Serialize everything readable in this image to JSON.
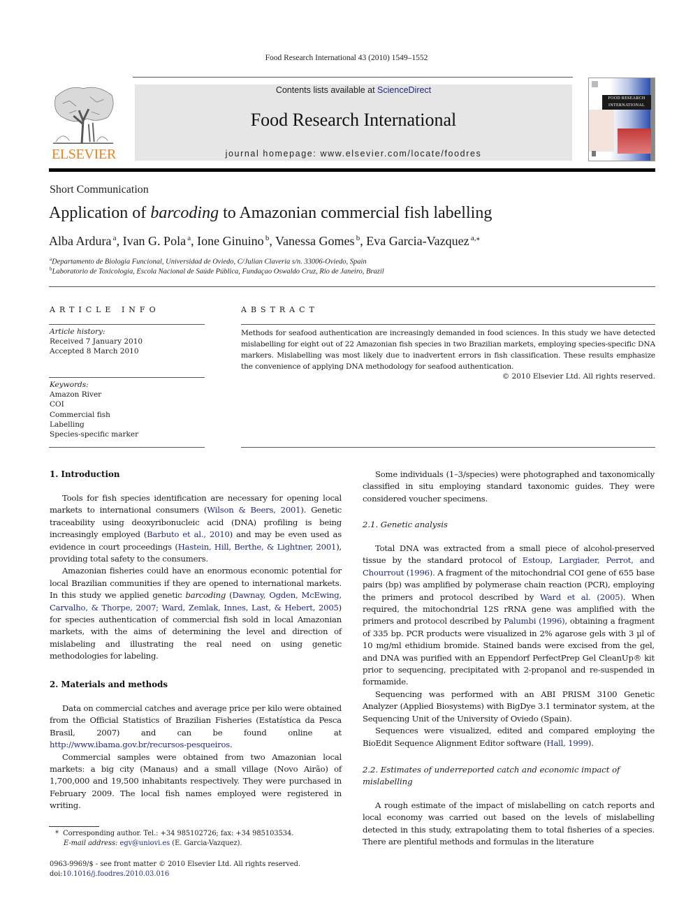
{
  "running_header": "Food Research International 43 (2010) 1549–1552",
  "masthead": {
    "publisher_logo_word": "ELSEVIER",
    "contents_prefix": "Contents lists available at ",
    "contents_link": "ScienceDirect",
    "journal_title": "Food Research International",
    "homepage_line": "journal homepage: www.elsevier.com/locate/foodres",
    "cover": {
      "title_line_1": "FOOD RESEARCH",
      "title_line_2": "INTERNATIONAL"
    },
    "colors": {
      "elsevier_orange": "#f07f1c",
      "link_blue": "#1f2a80",
      "box_grey": "#e6e6e6"
    }
  },
  "article": {
    "type": "Short Communication",
    "title_before": "Application of ",
    "title_italic": "barcoding",
    "title_after": " to Amazonian commercial fish labelling",
    "authors": [
      {
        "name": "Alba Ardura",
        "sup": "a",
        "sep": ", "
      },
      {
        "name": "Ivan G. Pola",
        "sup": "a",
        "sep": ", "
      },
      {
        "name": "Ione Ginuino",
        "sup": "b",
        "sep": ", "
      },
      {
        "name": "Vanessa Gomes",
        "sup": "b",
        "sep": ", "
      },
      {
        "name": "Eva Garcia-Vazquez",
        "sup": "a,⁎",
        "sep": ""
      }
    ],
    "affiliations": [
      {
        "sup": "a",
        "text": "Departamento de Biologia Funcional, Universidad de Oviedo, C/Julian Claveria s/n. 33006-Oviedo, Spain"
      },
      {
        "sup": "b",
        "text": "Laboratorio de Toxicologia, Escola Nacional de Saúde Pública, Fundaçao Oswaldo Cruz, Rio de Janeiro, Brazil"
      }
    ]
  },
  "article_info": {
    "heading": "ARTICLE INFO",
    "history_label": "Article history:",
    "received": "Received 7 January 2010",
    "accepted": "Accepted 8 March 2010",
    "keywords_label": "Keywords:",
    "keywords": [
      "Amazon River",
      "COI",
      "Commercial fish",
      "Labelling",
      "Species-specific marker"
    ]
  },
  "abstract": {
    "heading": "ABSTRACT",
    "text": "Methods for seafood authentication are increasingly demanded in food sciences. In this study we have detected mislabelling for eight out of 22 Amazonian fish species in two Brazilian markets, employing species-specific DNA markers. Mislabelling was most likely due to inadvertent errors in fish classification. These results emphasize the convenience of applying DNA methodology for seafood authentication.",
    "copyright": "© 2010 Elsevier Ltd. All rights reserved."
  },
  "sections": {
    "intro": {
      "heading": "1. Introduction",
      "p1": [
        {
          "t": "Tools for fish species identification are necessary for opening local markets to international consumers ("
        },
        {
          "t": "Wilson & Beers, 2001",
          "link": true
        },
        {
          "t": "). Genetic traceability using deoxyribonucleic acid (DNA) profiling is being increasingly employed ("
        },
        {
          "t": "Barbuto et al., 2010",
          "link": true
        },
        {
          "t": ") and may be even used as evidence in court proceedings ("
        },
        {
          "t": "Hastein, Hill, Berthe, & Lightner, 2001",
          "link": true
        },
        {
          "t": "), providing total safety to the consumers."
        }
      ],
      "p2": [
        {
          "t": "Amazonian fisheries could have an enormous economic potential for local Brazilian communities if they are opened to international markets. In this study we applied genetic "
        },
        {
          "t": "barcoding",
          "italic": true
        },
        {
          "t": " ("
        },
        {
          "t": "Dawnay, Ogden, McEwing, Carvalho, & Thorpe, 2007; Ward, Zemlak, Innes, Last, & Hebert, 2005",
          "link": true
        },
        {
          "t": ") for species authentication of commercial fish sold in local Amazonian markets, with the aims of determining the level and direction of mislabeling and illustrating the real need on using genetic methodologies for labeling."
        }
      ]
    },
    "methods": {
      "heading": "2. Materials and methods",
      "p1": [
        {
          "t": "Data on commercial catches and average price per kilo were obtained from the Official Statistics of Brazilian Fisheries (Estatística da Pesca Brasil, 2007) and can be found online at "
        },
        {
          "t": "http://www.ibama.gov.br/recursos-pesqueiros",
          "link": true
        },
        {
          "t": "."
        }
      ],
      "p2": [
        {
          "t": "Commercial samples were obtained from two Amazonian local markets: a big city (Manaus) and a small village (Novo Airão) of 1,700,000 and 19,500 inhabitants respectively. They were purchased in February 2009. The local fish names employed were registered in writing."
        }
      ],
      "p3": [
        {
          "t": "Some individuals (1–3/species) were photographed and taxonomically classified in situ employing standard taxonomic guides. They were considered voucher specimens."
        }
      ]
    },
    "genetic": {
      "heading": "2.1. Genetic analysis",
      "p1": [
        {
          "t": "Total DNA was extracted from a small piece of alcohol-preserved tissue by the standard protocol of "
        },
        {
          "t": "Estoup, Largiader, Perrot, and Chourrout (1996)",
          "link": true
        },
        {
          "t": ". A fragment of the mitochondrial COI gene of 655 base pairs (bp) was amplified by polymerase chain reaction (PCR), employing the primers and protocol described by "
        },
        {
          "t": "Ward et al. (2005)",
          "link": true
        },
        {
          "t": ". When required, the mitochondrial 12S rRNA gene was amplified with the primers and protocol described by "
        },
        {
          "t": "Palumbi (1996)",
          "link": true
        },
        {
          "t": ", obtaining a fragment of 335 bp. PCR products were visualized in 2% agarose gels with 3 µl of 10 mg/ml ethidium bromide. Stained bands were excised from the gel, and DNA was purified with an Eppendorf PerfectPrep Gel CleanUp® kit prior to sequencing, precipitated with 2-propanol and re-suspended in formamide."
        }
      ],
      "p2": [
        {
          "t": "Sequencing was performed with an ABI PRISM 3100 Genetic Analyzer (Applied Biosystems) with BigDye 3.1 terminator system, at the Sequencing Unit of the University of Oviedo (Spain)."
        }
      ],
      "p3": [
        {
          "t": "Sequences were visualized, edited and compared employing the BioEdit Sequence Alignment Editor software ("
        },
        {
          "t": "Hall, 1999",
          "link": true
        },
        {
          "t": ")."
        }
      ]
    },
    "estimates": {
      "heading": "2.2. Estimates of underreported catch and economic impact of mislabelling",
      "p1": [
        {
          "t": "A rough estimate of the impact of mislabelling on catch reports and local economy was carried out based on the levels of mislabelling detected in this study, extrapolating them to total fisheries of a species. There are plentiful methods and formulas in the literature"
        }
      ]
    }
  },
  "footnotes": {
    "corresponding_marker": "*",
    "corresponding": "Corresponding author. Tel.: +34 985102726; fax: +34 985103534.",
    "email_label": "E-mail address:",
    "email": "egv@uniovi.es",
    "email_suffix": " (E. Garcia-Vazquez).",
    "issn_line": "0963-9969/$ - see front matter © 2010 Elsevier Ltd. All rights reserved.",
    "doi_prefix": "doi:",
    "doi": "10.1016/j.foodres.2010.03.016"
  }
}
